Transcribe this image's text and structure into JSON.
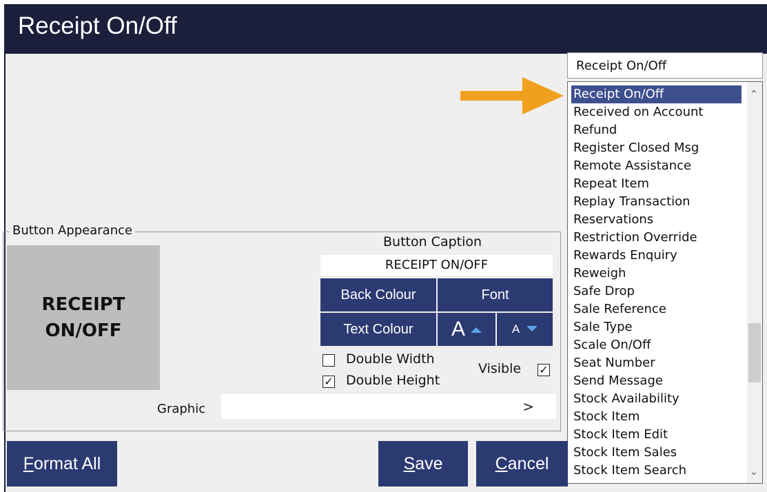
{
  "window": {
    "title": "Receipt On/Off"
  },
  "function_dropdown": {
    "selected": "Receipt On/Off",
    "items": [
      "Receipt On/Off",
      "Received on Account",
      "Refund",
      "Register Closed Msg",
      "Remote Assistance",
      "Repeat Item",
      "Replay Transaction",
      "Reservations",
      "Restriction Override",
      "Rewards Enquiry",
      "Reweigh",
      "Safe Drop",
      "Sale Reference",
      "Sale Type",
      "Scale On/Off",
      "Seat Number",
      "Send Message",
      "Stock Availability",
      "Stock Item",
      "Stock Item Edit",
      "Stock Item Sales",
      "Stock Item Search"
    ],
    "highlighted_index": 0
  },
  "button_appearance": {
    "group_label": "Button Appearance",
    "preview_text": "RECEIPT ON/OFF",
    "caption_label": "Button Caption",
    "caption_value": "RECEIPT ON/OFF",
    "back_colour_label": "Back Colour",
    "font_label": "Font",
    "text_colour_label": "Text Colour",
    "font_increase_glyph": "A",
    "font_decrease_glyph": "A",
    "double_width_label": "Double Width",
    "double_width_checked": false,
    "double_height_label": "Double Height",
    "double_height_checked": true,
    "visible_label": "Visible",
    "visible_checked": true,
    "graphic_label": "Graphic",
    "graphic_value": "",
    "graphic_browse": ">"
  },
  "footer": {
    "format_all_first": "F",
    "format_all_rest": "ormat All",
    "save_first": "S",
    "save_rest": "ave",
    "cancel_first": "C",
    "cancel_rest": "ancel"
  },
  "colors": {
    "title_bar": "#1b1f3b",
    "button_navy": "#2c3a72",
    "highlight": "#3e4f8e",
    "annotation_arrow": "#f0a01e"
  }
}
